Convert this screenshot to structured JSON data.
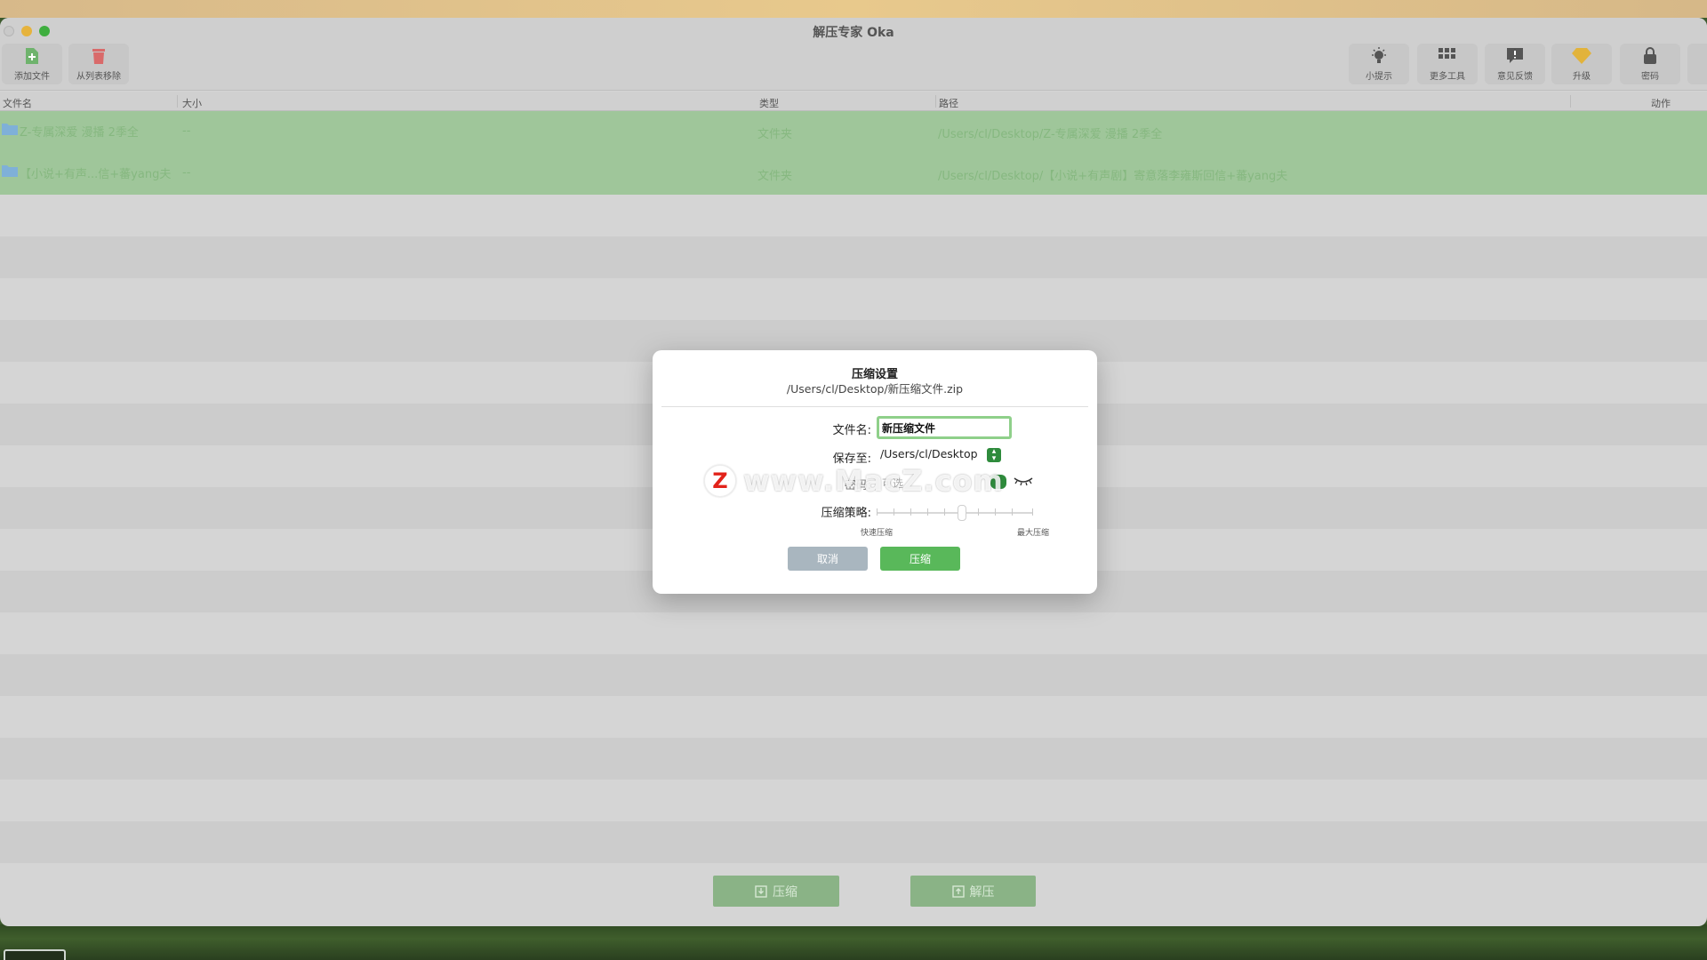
{
  "window": {
    "title": "解压专家 Oka"
  },
  "toolbar": {
    "add_file": "添加文件",
    "remove_from_list": "从列表移除",
    "tips": "小提示",
    "more_tools": "更多工具",
    "feedback": "意见反馈",
    "upgrade": "升级",
    "password": "密码"
  },
  "columns": {
    "name": "文件名",
    "size": "大小",
    "type": "类型",
    "path": "路径",
    "action": "动作"
  },
  "files": [
    {
      "name": "Z-专属深爱 漫播 2季全",
      "size": "--",
      "type": "文件夹",
      "path": "/Users/cl/Desktop/Z-专属深爱 漫播 2季全"
    },
    {
      "name": "【小说+有声...信+蕃yang夫",
      "size": "--",
      "type": "文件夹",
      "path": "/Users/cl/Desktop/【小说+有声剧】寄意落李雍斯回信+蕃yang夫"
    }
  ],
  "bottom": {
    "compress": "压缩",
    "extract": "解压"
  },
  "dialog": {
    "title": "压缩设置",
    "subtitle": "/Users/cl/Desktop/新压缩文件.zip",
    "filename_label": "文件名:",
    "filename_value": "新压缩文件",
    "save_label": "保存至:",
    "save_value": "/Users/cl/Desktop",
    "password_label": "密码:",
    "password_placeholder": "可选",
    "strategy_label": "压缩策略:",
    "slider_min": "快速压缩",
    "slider_max": "最大压缩",
    "cancel": "取消",
    "confirm": "压缩"
  },
  "watermark": {
    "letter": "Z",
    "text": "www.MacZ.com"
  }
}
